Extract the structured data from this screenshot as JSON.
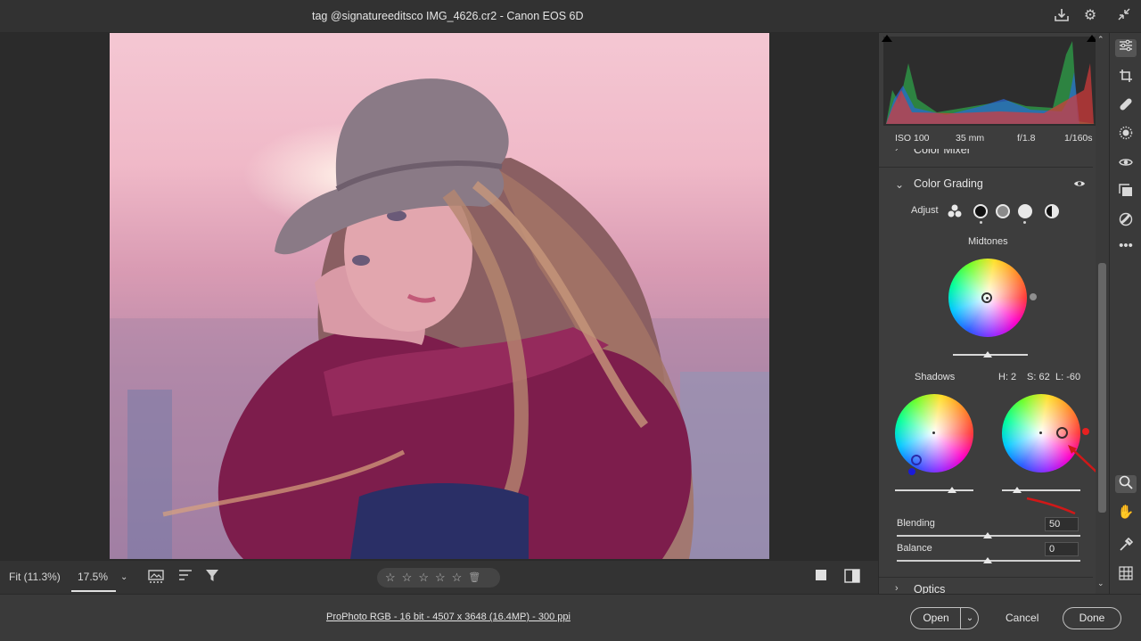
{
  "window": {
    "title": "tag @signatureeditsco IMG_4626.cr2  -  Canon EOS 6D"
  },
  "canvas_toolbar": {
    "fit_label": "Fit (11.3%)",
    "zoom_value": "17.5%",
    "rating_stars": 0
  },
  "footer": {
    "info_link": "ProPhoto RGB - 16 bit - 4507 x 3648 (16.4MP) - 300 ppi",
    "open_label": "Open",
    "cancel_label": "Cancel",
    "done_label": "Done"
  },
  "exif": {
    "iso": "ISO 100",
    "focal": "35 mm",
    "aperture": "f/1.8",
    "shutter": "1/160s"
  },
  "panel": {
    "color_mixer_label": "Color Mixer",
    "color_grading_label": "Color Grading",
    "adjust_label": "Adjust",
    "midtones_label": "Midtones",
    "shadows_label": "Shadows",
    "hsl_readout": {
      "h": "H: 2",
      "s": "S: 62",
      "l": "L: -60"
    },
    "blending_label": "Blending",
    "blending_value": "50",
    "balance_label": "Balance",
    "balance_value": "0",
    "optics_label": "Optics"
  },
  "colors": {
    "accent_arrow": "#e02020",
    "panel_bg": "#3d3d3d"
  }
}
